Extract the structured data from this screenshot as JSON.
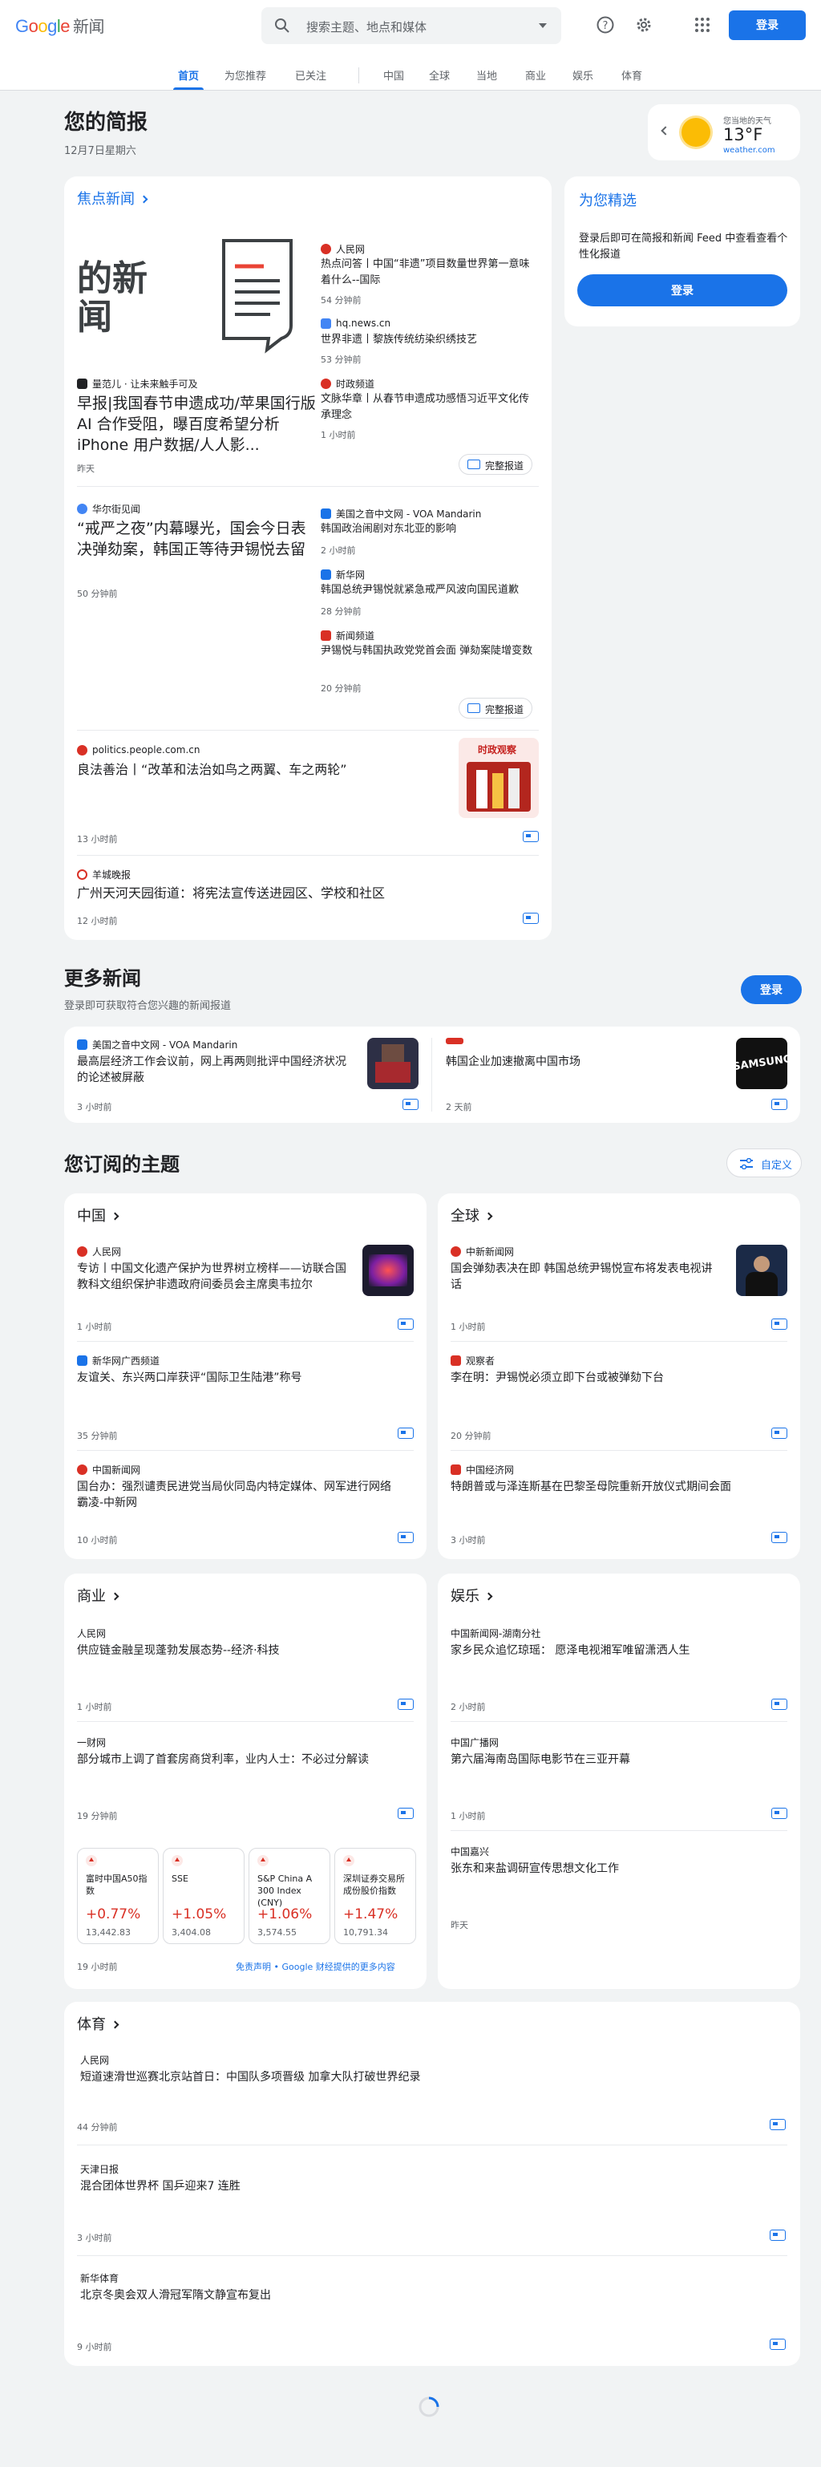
{
  "header": {
    "logo_google": "Google",
    "logo_news": "新闻",
    "search_placeholder": "搜索主题、地点和媒体",
    "login": "登录"
  },
  "tabs": [
    "首页",
    "为您推荐",
    "已关注",
    "中国",
    "全球",
    "当地",
    "商业",
    "娱乐",
    "体育"
  ],
  "briefing": {
    "title": "您的简报",
    "date": "12月7日星期六"
  },
  "weather": {
    "label": "您当地的天气",
    "temp": "13°F",
    "source": "weather.com"
  },
  "picks": {
    "title": "为您精选",
    "desc": "登录后即可在简报和新闻 Feed 中查看查看个性化报道",
    "login": "登录"
  },
  "top": {
    "title": "焦点新闻",
    "full_coverage": "完整报道",
    "c1": {
      "img_text": "的新闻",
      "main": {
        "source": "量范儿 · 让未来触手可及",
        "headline": "早报|我国春节申遗成功/苹果国行版AI 合作受阻，曝百度希望分析iPhone 用户数据/人人影...",
        "time": "昨天"
      },
      "side": [
        {
          "source": "人民网",
          "headline": "热点问答丨中国“非遗”项目数量世界第一意味着什么--国际",
          "time": "54 分钟前"
        },
        {
          "source": "hq.news.cn",
          "headline": "世界非遗丨黎族传统纺染织绣技艺",
          "time": "53 分钟前"
        },
        {
          "source": "时政频道",
          "headline": "文脉华章丨从春节申遗成功感悟习近平文化传承理念",
          "time": "1 小时前"
        }
      ]
    },
    "c2": {
      "main": {
        "source": "华尔街见闻",
        "headline": "“戒严之夜”内幕曝光，国会今日表决弹劾案，韩国正等待尹锡悦去留",
        "time": "50 分钟前"
      },
      "side": [
        {
          "source": "美国之音中文网 - VOA Mandarin",
          "headline": "韩国政治闹剧对东北亚的影响",
          "time": "2 小时前"
        },
        {
          "source": "新华网",
          "headline": "韩国总统尹锡悦就紧急戒严风波向国民道歉",
          "time": "28 分钟前"
        },
        {
          "source": "新闻频道",
          "headline": "尹锡悦与韩国执政党党首会面 弹劾案陡增变数",
          "time": "20 分钟前"
        }
      ]
    },
    "c3": {
      "source": "politics.people.com.cn",
      "headline": "良法善治丨“改革和法治如鸟之两翼、车之两轮”",
      "time": "13 小时前",
      "thumb_text": "时政观察"
    },
    "c4": {
      "source": "羊城晚报",
      "headline": "广州天河天园街道：将宪法宣传送进园区、学校和社区",
      "time": "12 小时前"
    }
  },
  "more": {
    "title": "更多新闻",
    "sub": "登录即可获取符合您兴趣的新闻报道",
    "login": "登录",
    "items": [
      {
        "source": "美国之音中文网 - VOA Mandarin",
        "headline": "最高层经济工作会议前，网上再两则批评中国经济状况的论述被屏蔽",
        "time": "3 小时前"
      },
      {
        "source": "",
        "headline": "韩国企业加速撤离中国市场",
        "time": "2 天前",
        "thumb_text": "SAMSUNG"
      }
    ]
  },
  "topics": {
    "title": "您订阅的主题",
    "customize": "自定义",
    "china": {
      "title": "中国",
      "items": [
        {
          "source": "人民网",
          "headline": "专访丨中国文化遗产保护为世界树立榜样——访联合国教科文组织保护非遗政府间委员会主席奥韦拉尔",
          "time": "1 小时前"
        },
        {
          "source": "新华网广西频道",
          "headline": "友谊关、东兴两口岸获评“国际卫生陆港”称号",
          "time": "35 分钟前"
        },
        {
          "source": "中国新闻网",
          "headline": "国台办：强烈谴责民进党当局伙同岛内特定媒体、网军进行网络霸凌-中新网",
          "time": "10 小时前"
        }
      ]
    },
    "world": {
      "title": "全球",
      "items": [
        {
          "source": "中新新闻网",
          "headline": "国会弹劾表决在即 韩国总统尹锡悦宣布将发表电视讲话",
          "time": "1 小时前"
        },
        {
          "source": "观察者",
          "headline": "李在明：尹锡悦必须立即下台或被弹劾下台",
          "time": "20 分钟前"
        },
        {
          "source": "中国经济网",
          "headline": "特朗普或与泽连斯基在巴黎圣母院重新开放仪式期间会面",
          "time": "3 小时前"
        }
      ]
    },
    "business": {
      "title": "商业",
      "items": [
        {
          "source": "人民网",
          "headline": "供应链金融呈现蓬勃发展态势--经济·科技",
          "time": "1 小时前"
        },
        {
          "source": "一财网",
          "headline": "部分城市上调了首套房商贷利率，业内人士：不必过分解读",
          "time": "19 分钟前"
        }
      ],
      "stocks": [
        {
          "name": "富时中国A50指数",
          "pct": "+0.77%",
          "val": "13,442.83"
        },
        {
          "name": "SSE",
          "pct": "+1.05%",
          "val": "3,404.08"
        },
        {
          "name": "S&P China A 300 Index (CNY)",
          "pct": "+1.06%",
          "val": "3,574.55"
        },
        {
          "name": "深圳证券交易所成份股价指数",
          "pct": "+1.47%",
          "val": "10,791.34"
        }
      ],
      "stocks_time": "19 小时前",
      "disclaimer": "免责声明 • Google 财经提供的更多内容"
    },
    "ent": {
      "title": "娱乐",
      "items": [
        {
          "source": "中国新闻网-湖南分社",
          "headline": "家乡民众追忆琼瑶： 愿泽电视湘军唯留潇洒人生",
          "time": "2 小时前"
        },
        {
          "source": "中国广播网",
          "headline": "第六届海南岛国际电影节在三亚开幕",
          "time": "1 小时前"
        },
        {
          "source": "中国嘉兴",
          "headline": "张东和来盐调研宣传思想文化工作",
          "time": "昨天"
        }
      ]
    },
    "sports": {
      "title": "体育",
      "items": [
        {
          "source": "人民网",
          "headline": "短道速滑世巡赛北京站首日：中国队多项晋级 加拿大队打破世界纪录",
          "time": "44 分钟前"
        },
        {
          "source": "天津日报",
          "headline": "混合团体世界杯 国乒迎来7 连胜",
          "time": "3 小时前"
        },
        {
          "source": "新华体育",
          "headline": "北京冬奥会双人滑冠军隋文静宣布复出",
          "time": "9 小时前"
        }
      ]
    }
  }
}
